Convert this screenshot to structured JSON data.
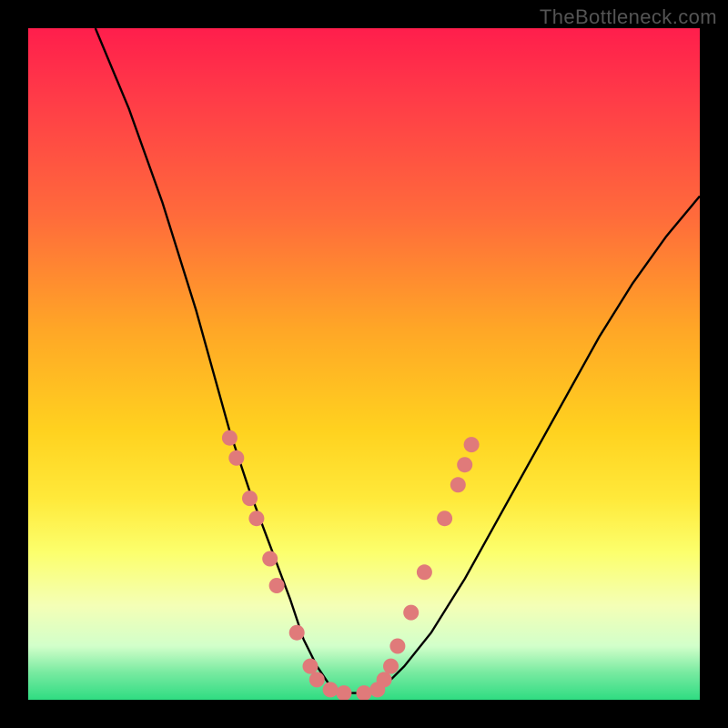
{
  "attribution": "TheBottleneck.com",
  "chart_data": {
    "type": "line",
    "title": "",
    "xlabel": "",
    "ylabel": "",
    "xlim": [
      0,
      100
    ],
    "ylim": [
      0,
      100
    ],
    "grid": false,
    "series": [
      {
        "name": "bottleneck-curve",
        "x": [
          10,
          15,
          20,
          25,
          30,
          33,
          36,
          39,
          41,
          43,
          45,
          47,
          50,
          53,
          56,
          60,
          65,
          70,
          75,
          80,
          85,
          90,
          95,
          100
        ],
        "y": [
          100,
          88,
          74,
          58,
          40,
          31,
          23,
          15,
          9,
          5,
          2,
          1,
          1,
          2,
          5,
          10,
          18,
          27,
          36,
          45,
          54,
          62,
          69,
          75
        ]
      }
    ],
    "markers": [
      {
        "x": 30,
        "y": 39
      },
      {
        "x": 31,
        "y": 36
      },
      {
        "x": 33,
        "y": 30
      },
      {
        "x": 34,
        "y": 27
      },
      {
        "x": 36,
        "y": 21
      },
      {
        "x": 37,
        "y": 17
      },
      {
        "x": 40,
        "y": 10
      },
      {
        "x": 42,
        "y": 5
      },
      {
        "x": 43,
        "y": 3
      },
      {
        "x": 45,
        "y": 1.5
      },
      {
        "x": 47,
        "y": 1
      },
      {
        "x": 50,
        "y": 1
      },
      {
        "x": 52,
        "y": 1.5
      },
      {
        "x": 53,
        "y": 3
      },
      {
        "x": 54,
        "y": 5
      },
      {
        "x": 55,
        "y": 8
      },
      {
        "x": 57,
        "y": 13
      },
      {
        "x": 59,
        "y": 19
      },
      {
        "x": 62,
        "y": 27
      },
      {
        "x": 64,
        "y": 32
      },
      {
        "x": 65,
        "y": 35
      },
      {
        "x": 66,
        "y": 38
      }
    ],
    "colors": {
      "curve": "#000000",
      "marker_fill": "#e07a7a",
      "marker_stroke": "#c96464"
    }
  }
}
